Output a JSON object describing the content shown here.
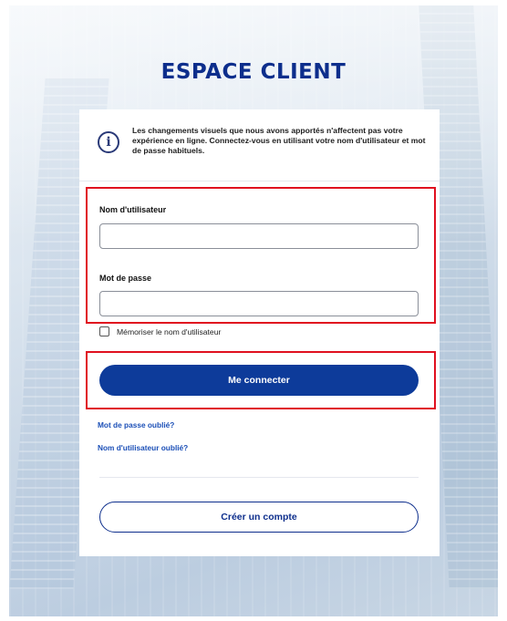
{
  "header": {
    "title": "ESPACE CLIENT"
  },
  "notice": {
    "icon": "info-icon",
    "text": "Les changements visuels que nous avons apportés n'affectent pas votre expérience en ligne. Connectez-vous en utilisant votre nom d'utilisateur et mot de passe habituels."
  },
  "form": {
    "username_label": "Nom d'utilisateur",
    "username_value": "",
    "password_label": "Mot de passe",
    "password_value": "",
    "password_toggle_icon": "eye-icon",
    "remember_label": "Mémoriser le nom d'utilisateur",
    "remember_checked": false,
    "submit_label": "Me connecter"
  },
  "links": {
    "forgot_password": "Mot de passe oublié?",
    "forgot_username": "Nom d'utilisateur oublié?"
  },
  "create_account_label": "Créer un compte",
  "colors": {
    "brand": "#0d2e8c",
    "primary_button": "#0d3b9a",
    "link": "#1b4fb7",
    "highlight": "#e0101f"
  }
}
